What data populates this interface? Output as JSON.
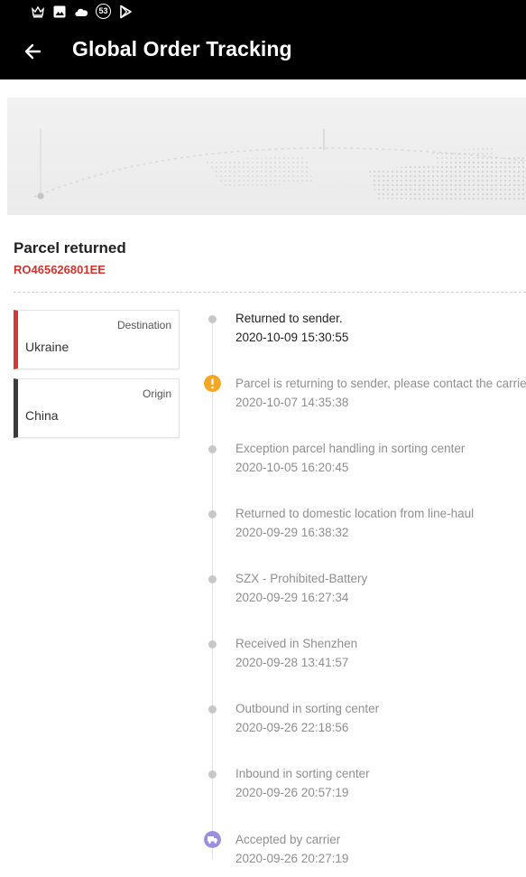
{
  "status_bar": {
    "icons": [
      "crown-icon",
      "image-icon",
      "cloud-icon",
      "notification-count-badge",
      "play-store-icon"
    ],
    "badge_count": "53"
  },
  "header": {
    "title": "Global Order Tracking",
    "back_icon": "arrow-left-icon"
  },
  "parcel": {
    "status": "Parcel returned",
    "tracking_number": "RO465626801EE"
  },
  "locations": {
    "destination": {
      "role": "Destination",
      "country": "Ukraine"
    },
    "origin": {
      "role": "Origin",
      "country": "China"
    }
  },
  "timeline": [
    {
      "description": "Returned to sender.",
      "time": "2020-10-09 15:30:55",
      "marker": "dot",
      "latest": true
    },
    {
      "description": "Parcel is returning to sender, please contact the carrier",
      "time": "2020-10-07 14:35:38",
      "marker": "warning-icon",
      "marker_color": "#f5a623"
    },
    {
      "description": "Exception parcel handling in sorting center",
      "time": "2020-10-05 16:20:45",
      "marker": "dot"
    },
    {
      "description": "Returned to domestic location from line-haul",
      "time": "2020-09-29 16:38:32",
      "marker": "dot"
    },
    {
      "description": "SZX - Prohibited-Battery",
      "time": "2020-09-29 16:27:34",
      "marker": "dot"
    },
    {
      "description": "Received in Shenzhen",
      "time": "2020-09-28 13:41:57",
      "marker": "dot"
    },
    {
      "description": "Outbound in sorting center",
      "time": "2020-09-26 22:18:56",
      "marker": "dot"
    },
    {
      "description": "Inbound in sorting center",
      "time": "2020-09-26 20:57:19",
      "marker": "dot"
    },
    {
      "description": "Accepted by carrier",
      "time": "2020-09-26 20:27:19",
      "marker": "truck-icon",
      "marker_color": "#9b8fe0"
    }
  ],
  "colors": {
    "destination_accent": "#d23b35",
    "origin_accent": "#3b3b3b",
    "tracking_number": "#d0342c",
    "app_bar": "#000000"
  }
}
